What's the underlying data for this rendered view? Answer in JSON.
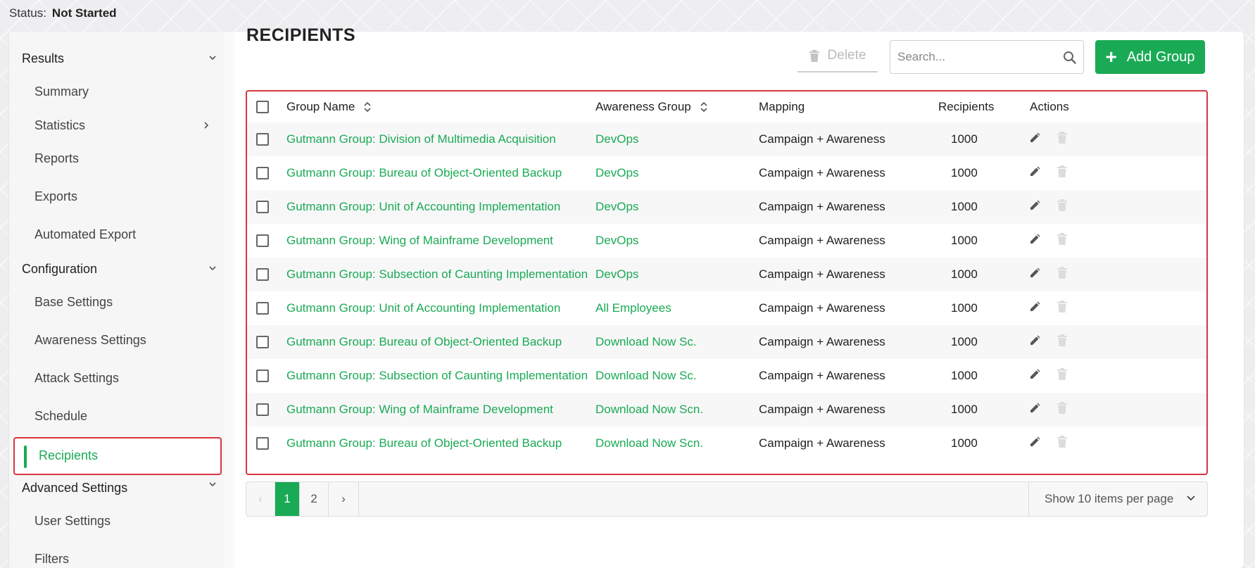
{
  "status": {
    "label": "Status:",
    "value": "Not Started"
  },
  "sidebar": {
    "sections": [
      {
        "label": "Results",
        "items": [
          {
            "label": "Summary"
          },
          {
            "label": "Statistics",
            "has_submenu": true
          },
          {
            "label": "Reports"
          },
          {
            "label": "Exports"
          },
          {
            "label": "Automated Export"
          }
        ]
      },
      {
        "label": "Configuration",
        "items": [
          {
            "label": "Base Settings"
          },
          {
            "label": "Awareness Settings"
          },
          {
            "label": "Attack Settings"
          },
          {
            "label": "Schedule"
          },
          {
            "label": "Recipients",
            "active": true
          }
        ]
      },
      {
        "label": "Advanced Settings",
        "items": [
          {
            "label": "User Settings"
          },
          {
            "label": "Filters"
          }
        ]
      }
    ]
  },
  "main": {
    "title": "RECIPIENTS",
    "delete_label": "Delete",
    "search_placeholder": "Search...",
    "add_label": "Add Group"
  },
  "table": {
    "columns": {
      "group_name": "Group Name",
      "awareness_group": "Awareness Group",
      "mapping": "Mapping",
      "recipients": "Recipients",
      "actions": "Actions"
    },
    "rows": [
      {
        "group": "Gutmann Group: Division of Multimedia Acquisition",
        "awareness": "DevOps",
        "mapping": "Campaign + Awareness",
        "recipients": "1000"
      },
      {
        "group": "Gutmann Group: Bureau of Object-Oriented Backup",
        "awareness": "DevOps",
        "mapping": "Campaign + Awareness",
        "recipients": "1000"
      },
      {
        "group": "Gutmann Group: Unit of Accounting Implementation",
        "awareness": "DevOps",
        "mapping": "Campaign + Awareness",
        "recipients": "1000"
      },
      {
        "group": "Gutmann Group: Wing of Mainframe Development",
        "awareness": "DevOps",
        "mapping": "Campaign + Awareness",
        "recipients": "1000"
      },
      {
        "group": "Gutmann Group: Subsection of Caunting Implementation",
        "awareness": "DevOps",
        "mapping": "Campaign + Awareness",
        "recipients": "1000"
      },
      {
        "group": "Gutmann Group: Unit of Accounting Implementation",
        "awareness": "All Employees",
        "mapping": "Campaign + Awareness",
        "recipients": "1000"
      },
      {
        "group": "Gutmann Group: Bureau of Object-Oriented Backup",
        "awareness": "Download Now Sc.",
        "mapping": "Campaign + Awareness",
        "recipients": "1000"
      },
      {
        "group": "Gutmann Group: Subsection of Caunting Implementation",
        "awareness": "Download Now Sc.",
        "mapping": "Campaign + Awareness",
        "recipients": "1000"
      },
      {
        "group": "Gutmann Group: Wing of Mainframe Development",
        "awareness": "Download Now Scn.",
        "mapping": "Campaign + Awareness",
        "recipients": "1000"
      },
      {
        "group": "Gutmann Group: Bureau of Object-Oriented Backup",
        "awareness": "Download Now Scn.",
        "mapping": "Campaign + Awareness",
        "recipients": "1000"
      }
    ]
  },
  "pagination": {
    "prev": "‹",
    "pages": [
      "1",
      "2"
    ],
    "current": "1",
    "next": "›",
    "per_page_label": "Show 10 items per page"
  },
  "colors": {
    "accent": "#1aaa55",
    "highlight": "#d8363d"
  }
}
